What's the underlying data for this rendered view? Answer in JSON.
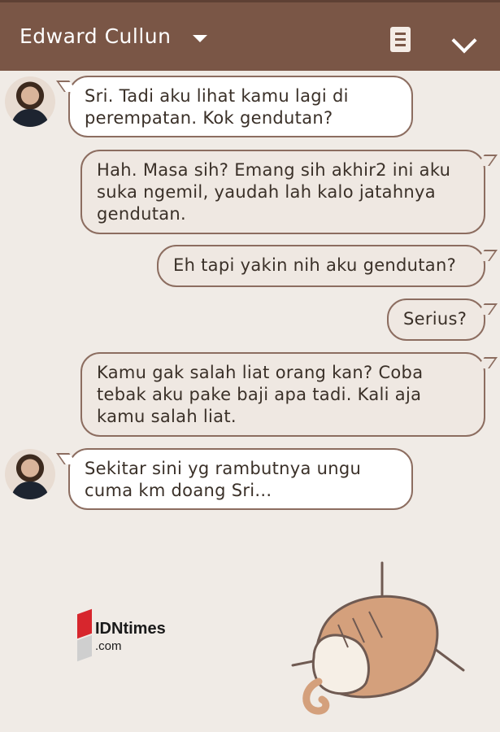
{
  "header": {
    "contact_name": "Edward Cullun"
  },
  "messages": [
    {
      "side": "in",
      "text": "Sri. Tadi aku lihat kamu lagi di perempatan. Kok gendutan?"
    },
    {
      "side": "out",
      "text": "Hah. Masa sih? Emang sih akhir2 ini aku suka ngemil, yaudah lah kalo jatahnya gendutan."
    },
    {
      "side": "out",
      "text": "Eh tapi yakin nih aku gendutan?"
    },
    {
      "side": "out",
      "text": "Serius?"
    },
    {
      "side": "out",
      "text": "Kamu gak salah liat orang kan? Coba tebak aku pake baji apa tadi. Kali aja kamu salah liat."
    },
    {
      "side": "in",
      "text": "Sekitar sini yg rambutnya ungu cuma km doang Sri..."
    }
  ],
  "watermark": {
    "brand": "IDNtimes",
    "domain": ".com"
  },
  "icons": {
    "dropdown": "caret-down-icon",
    "menu": "document-menu-icon",
    "collapse": "chevron-down-icon",
    "sticker": "cat-sticker"
  },
  "colors": {
    "header_bg": "#7a5646",
    "chat_bg": "#f0ebe6",
    "incoming_bubble": "#ffffff",
    "outgoing_bubble": "#efe8e2",
    "bubble_border": "#8c6d60"
  }
}
